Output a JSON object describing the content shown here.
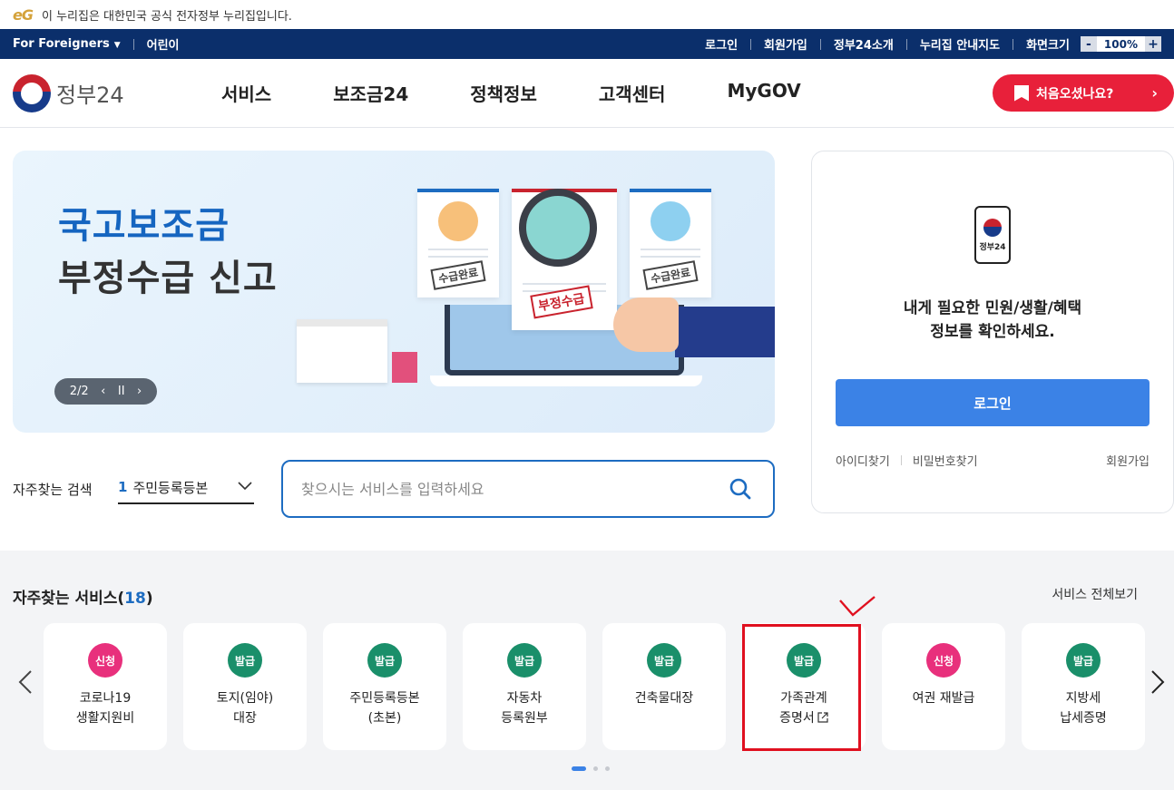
{
  "notice": {
    "logo_text": "eG",
    "text": "이 누리집은 대한민국 공식 전자정부 누리집입니다."
  },
  "util": {
    "foreigners": "For Foreigners",
    "kids": "어린이",
    "right_links": [
      "로그인",
      "회원가입",
      "정부24소개",
      "누리집 안내지도",
      "화면크기"
    ],
    "zoom_minus": "-",
    "zoom_value": "100%",
    "zoom_plus": "+"
  },
  "header": {
    "logo": "정부24",
    "menu": [
      "서비스",
      "보조금24",
      "정책정보",
      "고객센터",
      "MyGOV"
    ],
    "first_visit": "처음오셨나요?"
  },
  "hero": {
    "title_line1": "국고보조금",
    "title_line2": "부정수급 신고",
    "slide_counter": "2/2",
    "stamp_left": "수급완료",
    "stamp_center": "부정수급",
    "stamp_right": "수급완료"
  },
  "login": {
    "phone_label": "정부24",
    "message_line1": "내게 필요한 민원/생활/혜택",
    "message_line2": "정보를 확인하세요.",
    "button": "로그인",
    "find_id": "아이디찾기",
    "find_pw": "비밀번호찾기",
    "signup": "회원가입"
  },
  "search": {
    "freq_label": "자주찾는 검색",
    "freq_num": "1",
    "freq_value": "주민등록등본",
    "placeholder": "찾으시는 서비스를 입력하세요"
  },
  "services": {
    "title": "자주찾는 서비스(",
    "count": "18",
    "title_close": ")",
    "view_all": "서비스 전체보기",
    "items": [
      {
        "badge": "신청",
        "badge_color": "#e8307c",
        "line1": "코로나19",
        "line2": "생활지원비"
      },
      {
        "badge": "발급",
        "badge_color": "#1a8f6a",
        "line1": "토지(임야)",
        "line2": "대장"
      },
      {
        "badge": "발급",
        "badge_color": "#1a8f6a",
        "line1": "주민등록등본",
        "line2": "(초본)"
      },
      {
        "badge": "발급",
        "badge_color": "#1a8f6a",
        "line1": "자동차",
        "line2": "등록원부"
      },
      {
        "badge": "발급",
        "badge_color": "#1a8f6a",
        "line1": "건축물대장",
        "line2": ""
      },
      {
        "badge": "발급",
        "badge_color": "#1a8f6a",
        "line1": "가족관계",
        "line2": "증명서"
      },
      {
        "badge": "신청",
        "badge_color": "#e8307c",
        "line1": "여권 재발급",
        "line2": ""
      },
      {
        "badge": "발급",
        "badge_color": "#1a8f6a",
        "line1": "지방세",
        "line2": "납세증명"
      }
    ]
  },
  "colors": {
    "brand_navy": "#0b2f6b",
    "accent_red": "#e8203a",
    "primary_blue": "#3b82e6",
    "annotation_red": "#e0101f"
  }
}
